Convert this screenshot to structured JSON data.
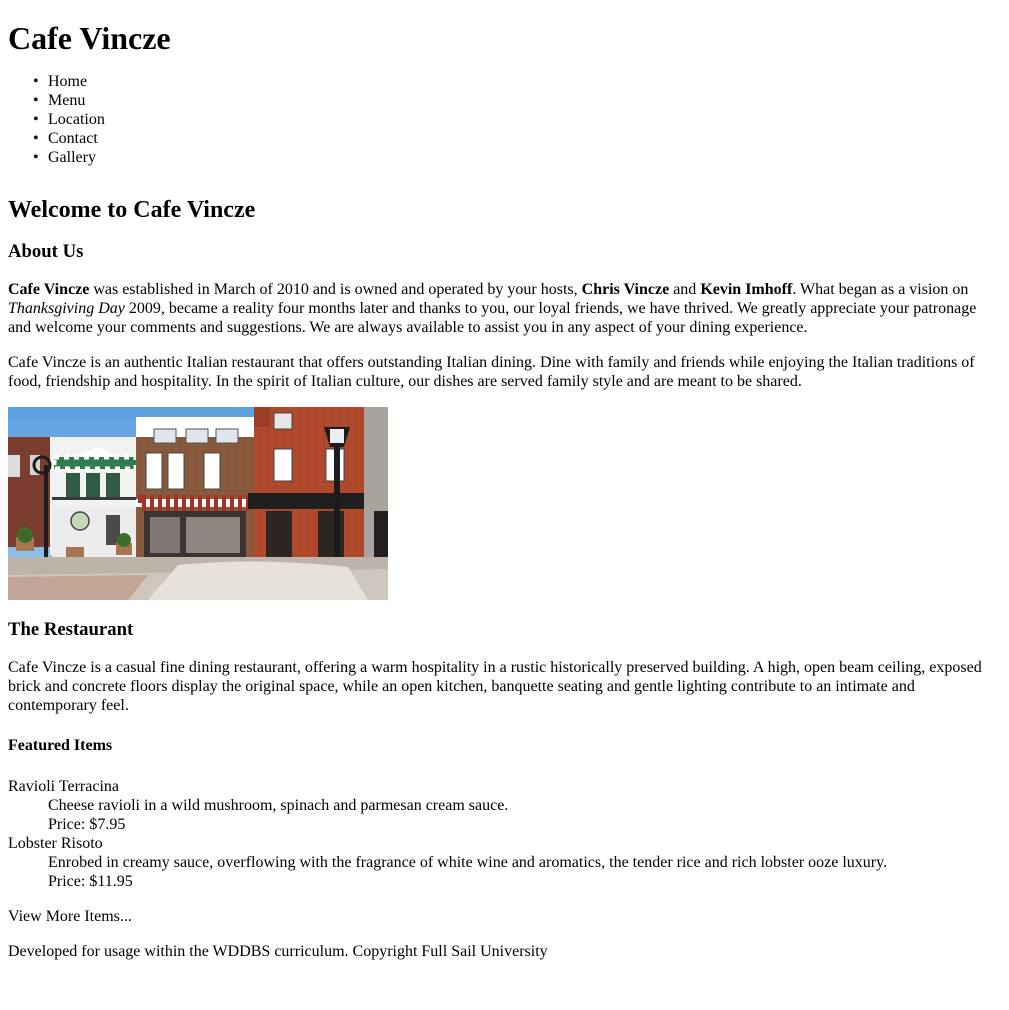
{
  "site": {
    "title": "Cafe Vincze"
  },
  "nav": {
    "items": [
      {
        "label": "Home"
      },
      {
        "label": "Menu"
      },
      {
        "label": "Location"
      },
      {
        "label": "Contact"
      },
      {
        "label": "Gallery"
      }
    ]
  },
  "main": {
    "heading": "Welcome to Cafe Vincze",
    "about": {
      "heading": "About Us",
      "p1": {
        "name": "Cafe Vincze",
        "t1": " was established in March of 2010 and is owned and operated by your hosts, ",
        "host1": "Chris Vincze",
        "t2": " and ",
        "host2": "Kevin Imhoff",
        "t3": ". What began as a vision on ",
        "holiday": "Thanksgiving Day",
        "t4": " 2009, became a reality four months later and thanks to you, our loyal friends, we have thrived. We greatly appreciate your patronage and welcome your comments and suggestions. We are always available to assist you in any aspect of your dining experience."
      },
      "p2": "Cafe Vincze is an authentic Italian restaurant that offers outstanding Italian dining. Dine with family and friends while enjoying the Italian traditions of food, friendship and hospitality. In the spirit of Italian culture, our dishes are served family style and are meant to be shared."
    },
    "restaurant": {
      "heading": "The Restaurant",
      "text": "Cafe Vincze is a casual fine dining restaurant, offering a warm hospitality in a rustic historically preserved building. A high, open beam ceiling, exposed brick and concrete floors display the original space, while an open kitchen, banquette seating and gentle lighting contribute to an intimate and contemporary feel."
    },
    "featured": {
      "heading": "Featured Items",
      "items": [
        {
          "name": "Ravioli Terracina",
          "description": "Cheese ravioli in a wild mushroom, spinach and parmesan cream sauce.",
          "price": "Price: $7.95"
        },
        {
          "name": "Lobster Risoto",
          "description": "Enrobed in creamy sauce, overflowing with the fragrance of white wine and aromatics, the tender rice and rich lobster ooze luxury.",
          "price": "Price: $11.95"
        }
      ],
      "more_link": "View More Items..."
    }
  },
  "footer": {
    "text": "Developed for usage within the WDDBS curriculum. Copyright Full Sail University"
  }
}
